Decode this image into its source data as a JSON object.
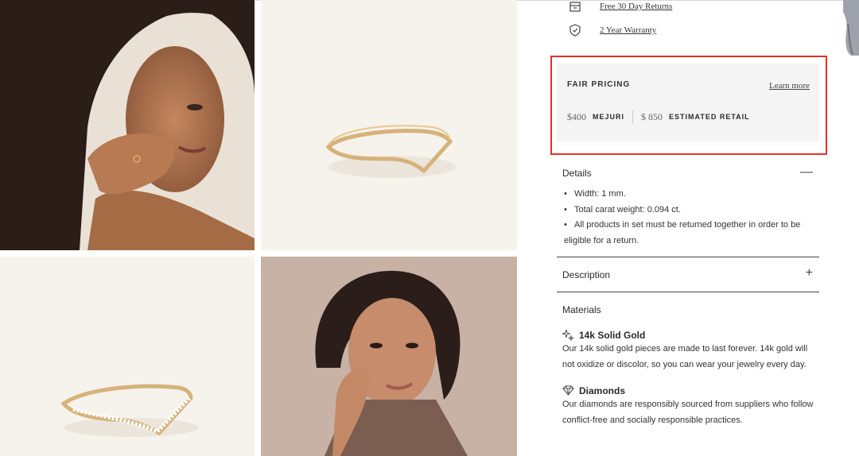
{
  "perks": [
    {
      "icon": "box-return-icon",
      "label": "Free 30 Day Returns"
    },
    {
      "icon": "shield-check-icon",
      "label": "2 Year Warranty"
    }
  ],
  "fair_pricing": {
    "title": "FAIR PRICING",
    "learn_more": "Learn more",
    "brand_price": "$400",
    "brand_label": "MEJURI",
    "retail_price": "$ 850",
    "retail_label": "ESTIMATED RETAIL",
    "highlight_color": "#e5302a"
  },
  "details": {
    "title": "Details",
    "toggle": "—",
    "bullets": [
      "Width: 1 mm.",
      "Total carat weight: 0.094 ct.",
      "All products in set must be returned together in order to be",
      "eligible for a return."
    ]
  },
  "description": {
    "title": "Description",
    "toggle": "+"
  },
  "materials": {
    "title": "Materials",
    "items": [
      {
        "icon": "sparkle-icon",
        "name": "14k Solid Gold",
        "text_lines": [
          "Our 14k solid gold pieces are made to last forever. 14k gold will",
          "not oxidize or discolor, so you can wear your jewelry every day."
        ]
      },
      {
        "icon": "diamond-icon",
        "name": "Diamonds",
        "text_lines": [
          "Our diamonds are responsibly sourced from suppliers who follow",
          "conflict-free and socially responsible practices."
        ]
      }
    ]
  },
  "gallery": {
    "images": [
      {
        "icon": "model-wearing-ring-photo"
      },
      {
        "icon": "gold-chevron-ring-photo"
      },
      {
        "icon": "diamond-chevron-ring-photo"
      },
      {
        "icon": "model-portrait-photo"
      }
    ]
  }
}
